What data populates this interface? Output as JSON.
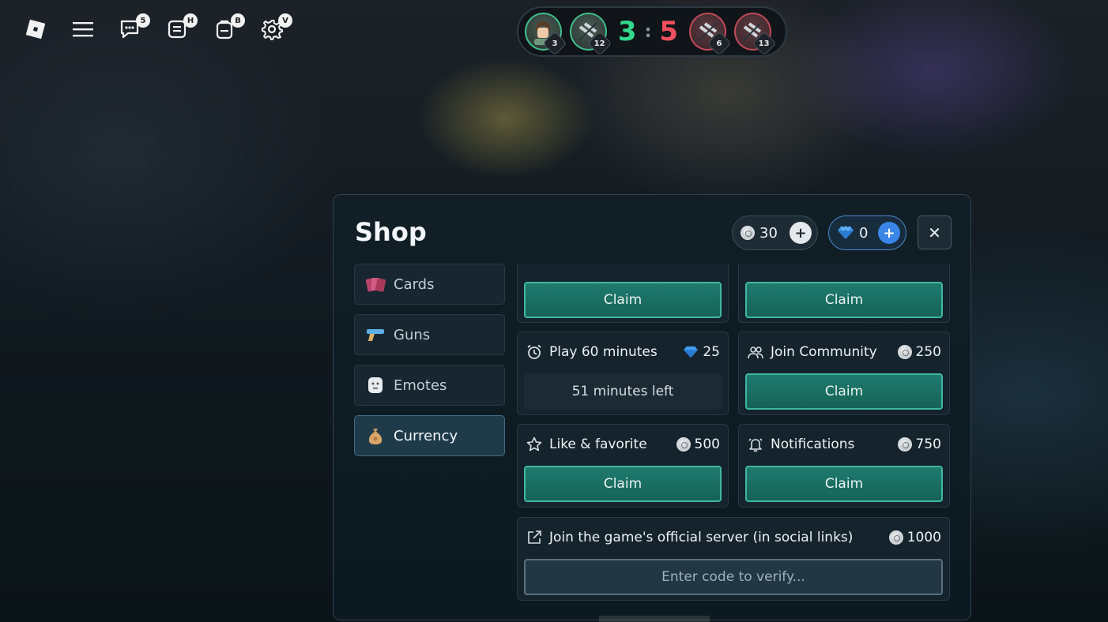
{
  "topbar": {
    "icons": [
      {
        "name": "roblox-logo-icon",
        "badge": ""
      },
      {
        "name": "menu-icon",
        "badge": ""
      },
      {
        "name": "chat-icon",
        "badge": "5"
      },
      {
        "name": "leaderboard-icon",
        "badge": "H"
      },
      {
        "name": "backpack-icon",
        "badge": "B"
      },
      {
        "name": "settings-icon",
        "badge": "V"
      }
    ]
  },
  "scoreboard": {
    "team_green": {
      "score": "3",
      "players": [
        {
          "level": "3"
        },
        {
          "level": "12"
        }
      ]
    },
    "separator": ":",
    "team_red": {
      "score": "5",
      "players": [
        {
          "level": "6"
        },
        {
          "level": "13"
        }
      ]
    },
    "colors": {
      "green": "#33d98a",
      "red": "#f0505e"
    }
  },
  "shop": {
    "title": "Shop",
    "coins": {
      "amount": "30",
      "icon": "coin-icon"
    },
    "gems": {
      "amount": "0",
      "icon": "gem-icon"
    },
    "close_label": "✕",
    "sidebar": [
      {
        "label": "Cards",
        "icon": "cards-icon",
        "active": false
      },
      {
        "label": "Guns",
        "icon": "gun-icon",
        "active": false
      },
      {
        "label": "Emotes",
        "icon": "emote-icon",
        "active": false
      },
      {
        "label": "Currency",
        "icon": "money-bag-icon",
        "active": true
      }
    ],
    "tasks": {
      "top_left_claim": "Claim",
      "top_right_claim": "Claim",
      "play": {
        "title": "Play 60 minutes",
        "reward": "25",
        "reward_icon": "gem-icon",
        "status": "51 minutes left"
      },
      "community": {
        "title": "Join Community",
        "reward": "250",
        "reward_icon": "coin-icon",
        "button": "Claim"
      },
      "like": {
        "title": "Like & favorite",
        "reward": "500",
        "reward_icon": "coin-icon",
        "button": "Claim"
      },
      "notifications": {
        "title": "Notifications",
        "reward": "750",
        "reward_icon": "coin-icon",
        "button": "Claim"
      },
      "server": {
        "title": "Join the game's official server (in social links)",
        "reward": "1000",
        "reward_icon": "coin-icon",
        "placeholder": "Enter code to verify..."
      }
    }
  }
}
